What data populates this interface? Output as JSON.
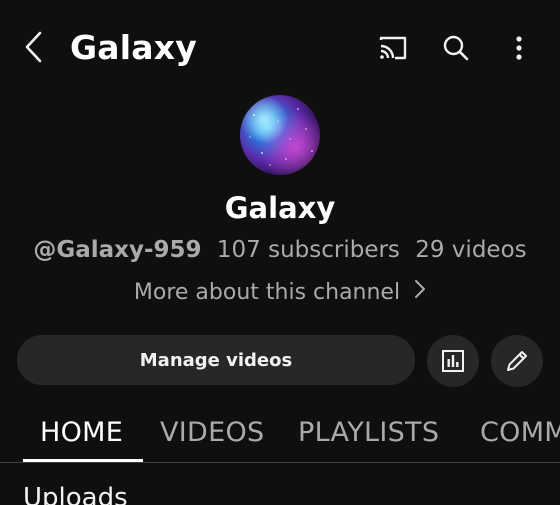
{
  "header": {
    "title": "Galaxy",
    "icons": {
      "back": "back-arrow-icon",
      "cast": "cast-icon",
      "search": "search-icon",
      "more": "more-vert-icon"
    }
  },
  "channel": {
    "name": "Galaxy",
    "handle": "@Galaxy-959",
    "subscribers": "107 subscribers",
    "videos": "29 videos",
    "about_link": "More about this channel"
  },
  "actions": {
    "manage_videos": "Manage videos",
    "analytics_icon": "analytics-icon",
    "edit_icon": "edit-pencil-icon"
  },
  "tabs": [
    {
      "label": "HOME",
      "active": true
    },
    {
      "label": "VIDEOS",
      "active": false
    },
    {
      "label": "PLAYLISTS",
      "active": false
    },
    {
      "label": "COMM",
      "active": false
    }
  ],
  "section": {
    "title": "Uploads"
  },
  "colors": {
    "background": "#0f0f0f",
    "button_bg": "#272727",
    "text_primary": "#f1f1f1",
    "text_secondary": "#aaaaaa",
    "tab_indicator": "#ffffff"
  }
}
